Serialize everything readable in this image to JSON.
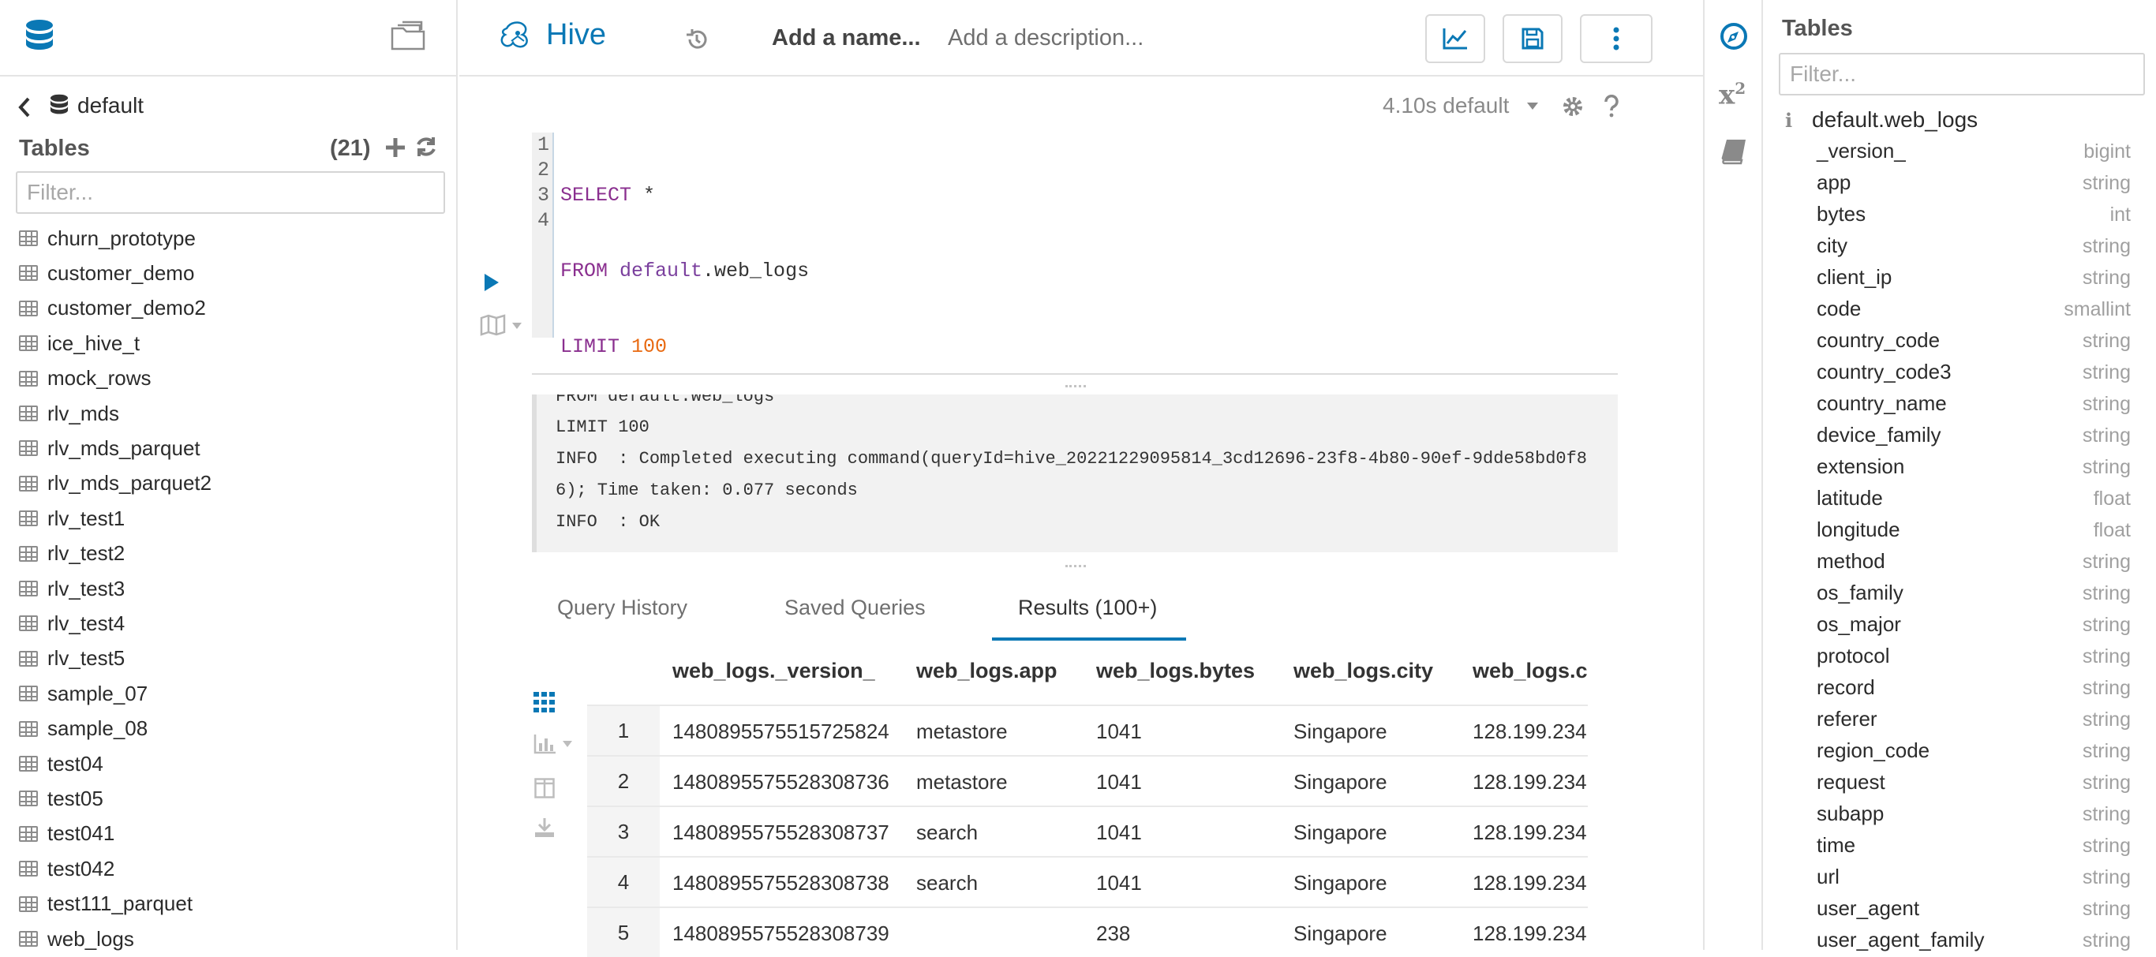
{
  "left": {
    "database": "default",
    "tables_heading": "Tables",
    "table_count": "(21)",
    "filter_placeholder": "Filter...",
    "tables": [
      "churn_prototype",
      "customer_demo",
      "customer_demo2",
      "ice_hive_t",
      "mock_rows",
      "rlv_mds",
      "rlv_mds_parquet",
      "rlv_mds_parquet2",
      "rlv_test1",
      "rlv_test2",
      "rlv_test3",
      "rlv_test4",
      "rlv_test5",
      "sample_07",
      "sample_08",
      "test04",
      "test05",
      "test041",
      "test042",
      "test111_parquet",
      "web_logs"
    ]
  },
  "topbar": {
    "app_name": "Hive",
    "name_placeholder": "Add a name...",
    "description_placeholder": "Add a description..."
  },
  "editor": {
    "status": "4.10s default",
    "lines": [
      "1",
      "2",
      "3",
      "4"
    ],
    "code": {
      "l1_kw": "SELECT",
      "l1_rest": " *",
      "l2_kw": "FROM",
      "l2_db": " default",
      "l2_rest": ".web_logs",
      "l3_kw": "LIMIT",
      "l3_num": " 100",
      "l4": ";"
    }
  },
  "log": {
    "lines": [
      "FROM default.web_logs",
      "LIMIT 100",
      "INFO  : Completed executing command(queryId=hive_20221229095814_3cd12696-23f8-4b80-90ef-9dde58bd0f8",
      "6); Time taken: 0.077 seconds",
      "INFO  : OK"
    ]
  },
  "tabs": {
    "history": "Query History",
    "saved": "Saved Queries",
    "results": "Results (100+)"
  },
  "results": {
    "headers": [
      "web_logs._version_",
      "web_logs.app",
      "web_logs.bytes",
      "web_logs.city",
      "web_logs.cl"
    ],
    "rows": [
      {
        "n": "1",
        "version": "1480895575515725824",
        "app": "metastore",
        "bytes": "1041",
        "city": "Singapore",
        "ip": "128.199.234"
      },
      {
        "n": "2",
        "version": "1480895575528308736",
        "app": "metastore",
        "bytes": "1041",
        "city": "Singapore",
        "ip": "128.199.234"
      },
      {
        "n": "3",
        "version": "1480895575528308737",
        "app": "search",
        "bytes": "1041",
        "city": "Singapore",
        "ip": "128.199.234"
      },
      {
        "n": "4",
        "version": "1480895575528308738",
        "app": "search",
        "bytes": "1041",
        "city": "Singapore",
        "ip": "128.199.234"
      },
      {
        "n": "5",
        "version": "1480895575528308739",
        "app": "",
        "bytes": "238",
        "city": "Singapore",
        "ip": "128.199.234"
      }
    ]
  },
  "right": {
    "heading": "Tables",
    "filter_placeholder": "Filter...",
    "table_name": "default.web_logs",
    "columns": [
      {
        "name": "_version_",
        "type": "bigint"
      },
      {
        "name": "app",
        "type": "string"
      },
      {
        "name": "bytes",
        "type": "int"
      },
      {
        "name": "city",
        "type": "string"
      },
      {
        "name": "client_ip",
        "type": "string"
      },
      {
        "name": "code",
        "type": "smallint"
      },
      {
        "name": "country_code",
        "type": "string"
      },
      {
        "name": "country_code3",
        "type": "string"
      },
      {
        "name": "country_name",
        "type": "string"
      },
      {
        "name": "device_family",
        "type": "string"
      },
      {
        "name": "extension",
        "type": "string"
      },
      {
        "name": "latitude",
        "type": "float"
      },
      {
        "name": "longitude",
        "type": "float"
      },
      {
        "name": "method",
        "type": "string"
      },
      {
        "name": "os_family",
        "type": "string"
      },
      {
        "name": "os_major",
        "type": "string"
      },
      {
        "name": "protocol",
        "type": "string"
      },
      {
        "name": "record",
        "type": "string"
      },
      {
        "name": "referer",
        "type": "string"
      },
      {
        "name": "region_code",
        "type": "string"
      },
      {
        "name": "request",
        "type": "string"
      },
      {
        "name": "subapp",
        "type": "string"
      },
      {
        "name": "time",
        "type": "string"
      },
      {
        "name": "url",
        "type": "string"
      },
      {
        "name": "user_agent",
        "type": "string"
      },
      {
        "name": "user_agent_family",
        "type": "string"
      }
    ]
  },
  "colors": {
    "accent": "#0a78b5",
    "border": "#e4e4e4",
    "keyword": "#8a2f8f",
    "number": "#e86a12"
  }
}
